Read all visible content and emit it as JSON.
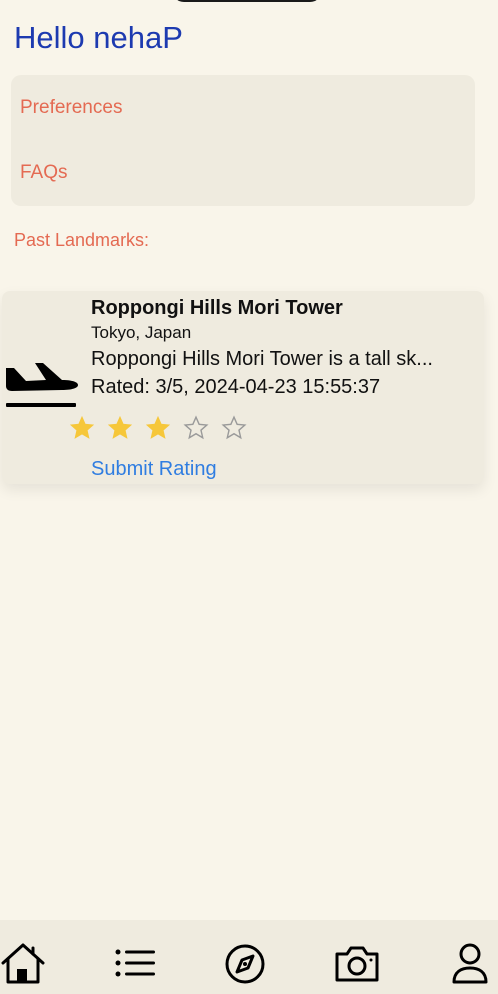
{
  "header": {
    "greeting": "Hello nehaP"
  },
  "menu": {
    "items": [
      {
        "label": "Preferences"
      },
      {
        "label": "FAQs"
      }
    ]
  },
  "past_landmarks": {
    "label": "Past Landmarks:",
    "items": [
      {
        "icon": "airplane-departure-icon",
        "name": "Roppongi Hills Mori Tower",
        "location": "Tokyo, Japan",
        "description": "Roppongi Hills Mori Tower is a tall sk...",
        "rated": "Rated: 3/5, 2024-04-23 15:55:37",
        "rating": 3,
        "max_rating": 5,
        "submit_label": "Submit Rating"
      }
    ]
  },
  "tabbar": {
    "tabs": [
      {
        "icon": "home-icon"
      },
      {
        "icon": "list-icon"
      },
      {
        "icon": "compass-icon"
      },
      {
        "icon": "camera-icon"
      },
      {
        "icon": "profile-icon"
      }
    ]
  },
  "colors": {
    "background": "#f9f5ea",
    "card": "#efebdf",
    "greeting": "#1d3ab0",
    "menu_text": "#e46a52",
    "link": "#2f7de1",
    "star_filled": "#f6c73a",
    "star_empty": "#9a9a9a"
  }
}
